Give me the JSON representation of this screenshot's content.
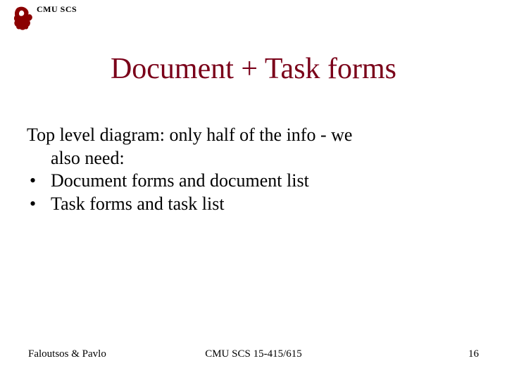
{
  "header": {
    "org_label": "CMU SCS",
    "logo_name": "cmu-scotty-icon"
  },
  "title": "Document + Task forms",
  "body": {
    "intro_line1": "Top level diagram: only half of the info - we",
    "intro_line2": "also need:",
    "bullets": [
      "Document forms and document list",
      "Task forms and task list"
    ]
  },
  "footer": {
    "left": "Faloutsos & Pavlo",
    "center": "CMU SCS 15-415/615",
    "right": "16"
  },
  "colors": {
    "title_color": "#7a0019",
    "logo_color": "#8b0000"
  }
}
